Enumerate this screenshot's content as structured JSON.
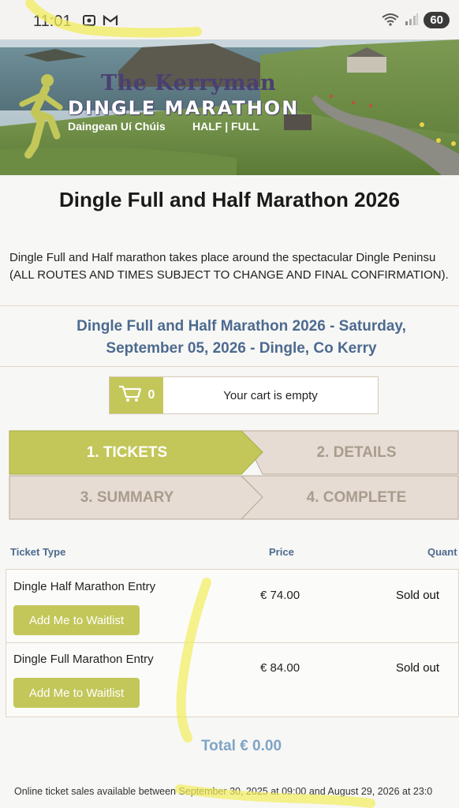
{
  "status_bar": {
    "time": "11:01",
    "battery": "60"
  },
  "banner": {
    "brand_the": "The Kerryman",
    "brand_main": "DINGLE MARATHON",
    "brand_irish": "Daingean Uí Chúis",
    "brand_half_full": "HALF | FULL"
  },
  "page": {
    "title": "Dingle Full and Half Marathon 2026",
    "intro_line1": "Dingle Full and Half marathon takes place around the spectacular Dingle Peninsu",
    "intro_line2": "(ALL ROUTES AND TIMES SUBJECT TO CHANGE AND FINAL CONFIRMATION).",
    "event_line1": "Dingle Full and Half Marathon 2026 - Saturday,",
    "event_line2": "September 05, 2026 - Dingle, Co Kerry"
  },
  "cart": {
    "count": "0",
    "text": "Your cart is empty"
  },
  "steps": [
    {
      "label": "1. TICKETS",
      "active": true
    },
    {
      "label": "2. DETAILS",
      "active": false
    },
    {
      "label": "3. SUMMARY",
      "active": false
    },
    {
      "label": "4. COMPLETE",
      "active": false
    }
  ],
  "table": {
    "headers": {
      "type": "Ticket Type",
      "price": "Price",
      "quantity": "Quant"
    },
    "rows": [
      {
        "name": "Dingle Half Marathon Entry",
        "price": "€ 74.00",
        "status": "Sold out",
        "button": "Add Me to Waitlist"
      },
      {
        "name": "Dingle Full Marathon Entry",
        "price": "€ 84.00",
        "status": "Sold out",
        "button": "Add Me to Waitlist"
      }
    ]
  },
  "total": "Total € 0.00",
  "footer": "Online ticket sales available between September 30, 2025 at 09:00 and August 29, 2026 at 23:0",
  "colors": {
    "accent_green": "#c3c75a",
    "step_inactive": "#e6dcd3",
    "title_blue": "#4d6a8f",
    "total_blue": "#7fa4c7",
    "highlighter": "#f2ec5c"
  },
  "icons": [
    "screenshot-icon",
    "gmail-icon",
    "wifi-icon",
    "signal-icon",
    "cart-icon",
    "runner-icon"
  ]
}
